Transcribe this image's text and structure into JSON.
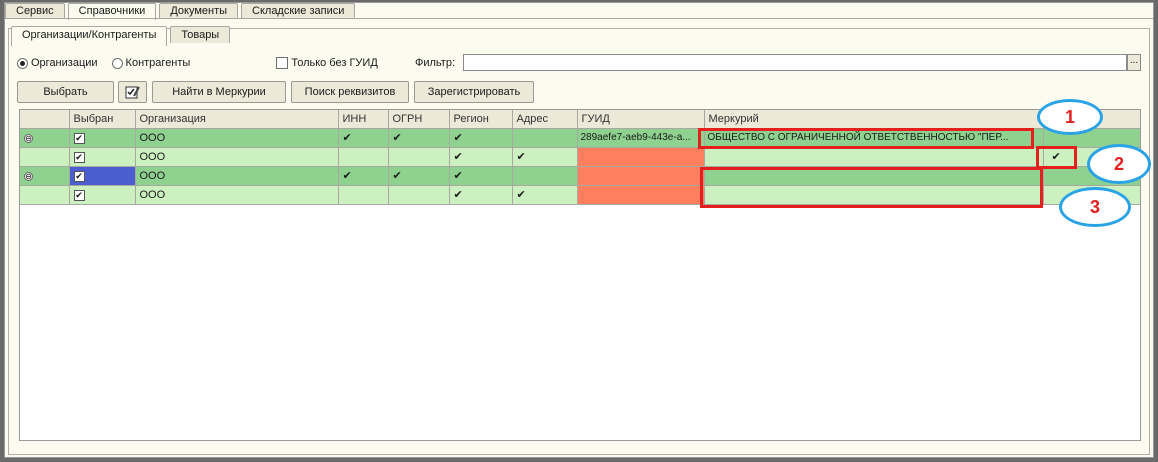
{
  "top_tabs": [
    "Сервис",
    "Справочники",
    "Документы",
    "Складские записи"
  ],
  "inner_tabs": [
    "Организации/Контрагенты",
    "Товары"
  ],
  "options": {
    "radio1": "Организации",
    "radio2": "Контрагенты",
    "checkbox": "Только без ГУИД",
    "filter_label": "Фильтр:",
    "filter_btn": "..."
  },
  "toolbar": {
    "select": "Выбрать",
    "find": "Найти в Меркурии",
    "search_req": "Поиск реквизитов",
    "register": "Зарегистрировать"
  },
  "columns": [
    "",
    "Выбран",
    "Организация",
    "ИНН",
    "ОГРН",
    "Регион",
    "Адрес",
    "ГУИД",
    "Меркурий",
    ""
  ],
  "rows": [
    {
      "org": "ООО",
      "guid": "289aefe7-aeb9-443e-a...",
      "merc": "ОБЩЕСТВО С ОГРАНИЧЕННОЙ ОТВЕТСТВЕННОСТЬЮ \"ПЕР..."
    },
    {
      "org": "ООО",
      "guid": "",
      "merc": ""
    },
    {
      "org": "ООО",
      "guid": "",
      "merc": ""
    },
    {
      "org": "ООО",
      "guid": "",
      "merc": ""
    }
  ],
  "check_glyph": "✔",
  "tree_glyph": "⊖",
  "callouts": [
    "1",
    "2",
    "3"
  ],
  "colors": {
    "row_dark": "#8fd28f",
    "row_light": "#cdf0c0",
    "guid_missing": "#ff7f5e",
    "annotation_red": "#e51e1e",
    "callout_blue": "#2aa3e6"
  }
}
